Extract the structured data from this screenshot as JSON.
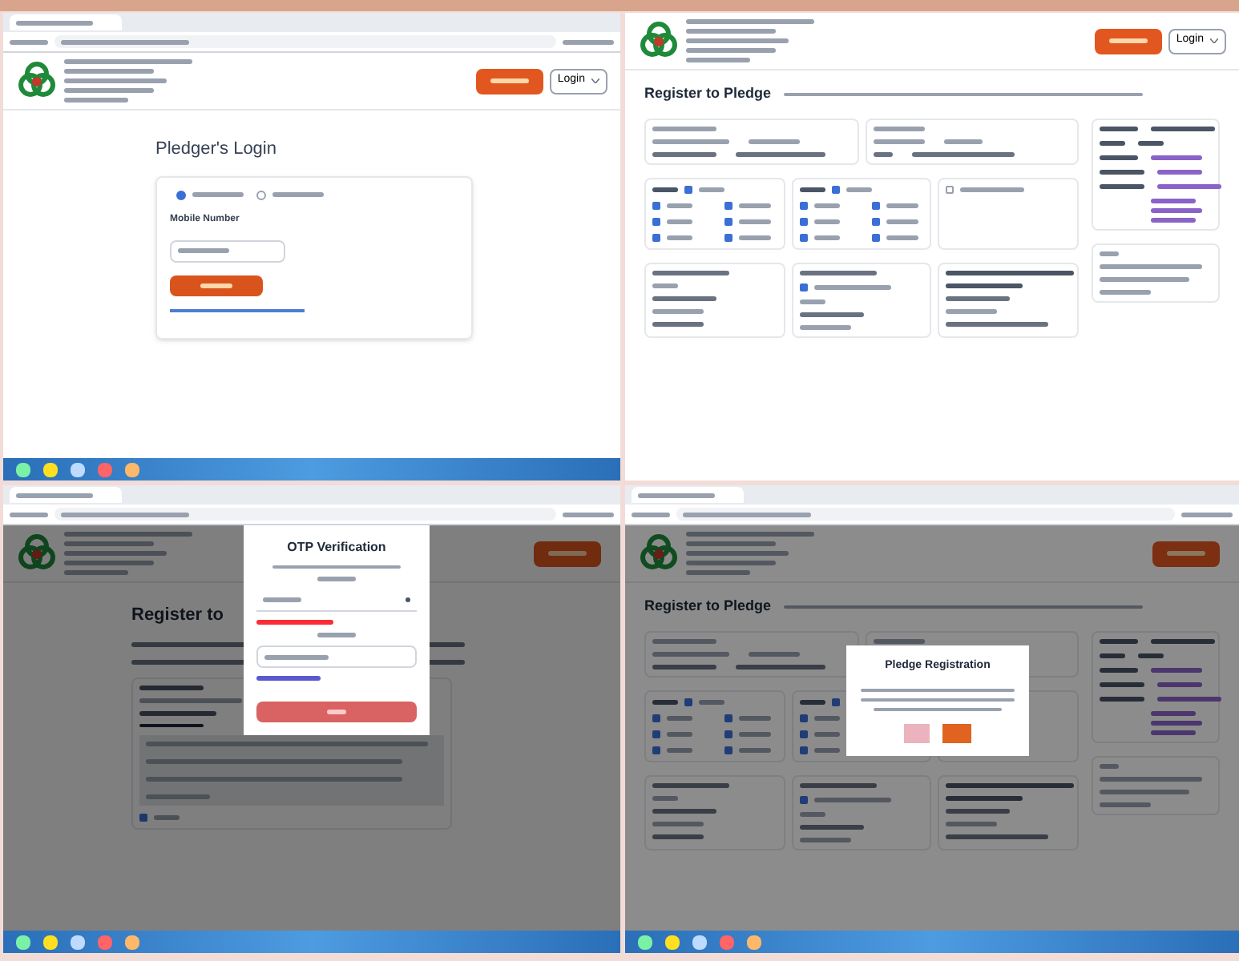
{
  "panels": [
    {
      "kind": "login",
      "title": "Pledger's Login",
      "language": "Login",
      "radio_options": [
        {
          "selected": true
        },
        {
          "selected": false
        }
      ],
      "field_label": "Mobile Number"
    },
    {
      "kind": "register",
      "title": "Register to Pledge",
      "language": "Login",
      "checkboxes": [
        {
          "checked": true
        },
        {
          "checked": true
        },
        {
          "checked": true
        },
        {
          "checked": true
        },
        {
          "checked": true
        },
        {
          "checked": true
        },
        {
          "checked": true
        },
        {
          "checked": true
        },
        {
          "checked": true
        },
        {
          "checked": true
        },
        {
          "checked": true
        },
        {
          "checked": true
        },
        {
          "checked": true
        },
        {
          "checked": true
        },
        {
          "checked": false
        },
        {
          "checked": true
        }
      ]
    },
    {
      "kind": "otp",
      "title": "Register to",
      "dialog_title": "OTP Verification",
      "checkboxes": [
        {
          "checked": true
        }
      ]
    },
    {
      "kind": "confirm",
      "title": "Register to Pledge",
      "dialog_title": "Pledge Registration",
      "checkboxes": [
        {
          "checked": true
        },
        {
          "checked": true
        },
        {
          "checked": true
        },
        {
          "checked": true
        },
        {
          "checked": true
        },
        {
          "checked": true
        },
        {
          "checked": true
        },
        {
          "checked": true
        },
        {
          "checked": true
        },
        {
          "checked": true
        },
        {
          "checked": true
        },
        {
          "checked": true
        }
      ]
    }
  ]
}
